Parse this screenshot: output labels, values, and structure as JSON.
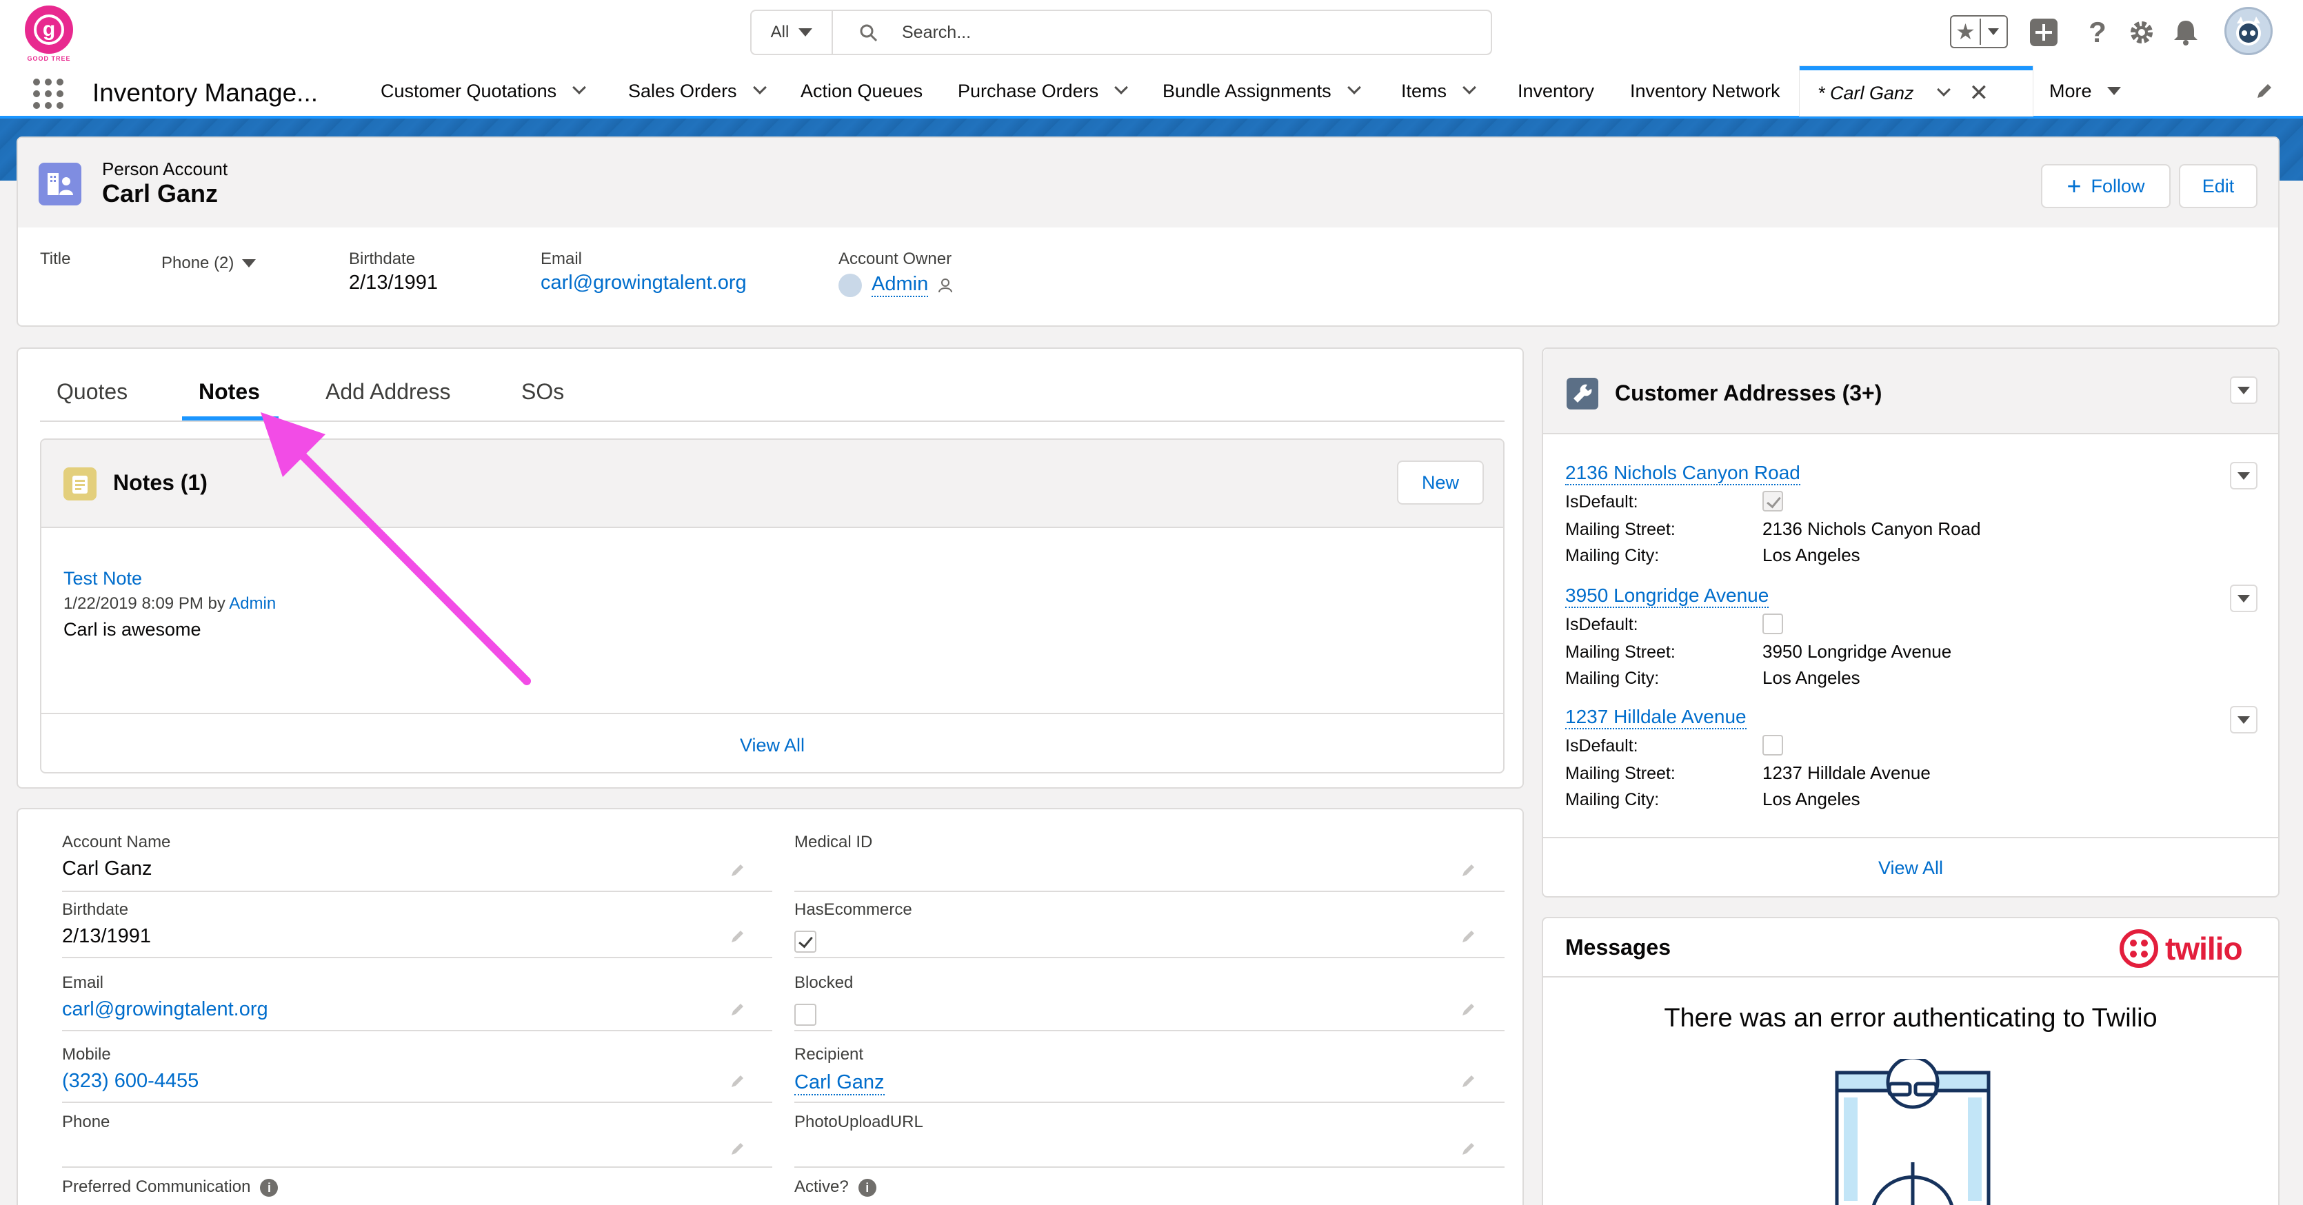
{
  "header": {
    "logo_text": "g",
    "logo_caption": "GOOD TREE",
    "search_scope": "All",
    "search_placeholder": "Search..."
  },
  "nav": {
    "app_name": "Inventory Manage...",
    "items": [
      {
        "label": "Customer Quotations"
      },
      {
        "label": "Sales Orders"
      },
      {
        "label": "Action Queues"
      },
      {
        "label": "Purchase Orders"
      },
      {
        "label": "Bundle Assignments"
      },
      {
        "label": "Items"
      },
      {
        "label": "Inventory"
      },
      {
        "label": "Inventory Network"
      }
    ],
    "active_tab": "* Carl Ganz",
    "more": "More"
  },
  "record": {
    "type": "Person Account",
    "name": "Carl Ganz",
    "follow_label": "Follow",
    "edit_label": "Edit",
    "title_label": "Title",
    "phone_label": "Phone (2)",
    "birthdate_label": "Birthdate",
    "birthdate": "2/13/1991",
    "email_label": "Email",
    "email": "carl@growingtalent.org",
    "owner_label": "Account Owner",
    "owner": "Admin"
  },
  "tabs": {
    "items": [
      "Quotes",
      "Notes",
      "Add Address",
      "SOs"
    ]
  },
  "notes": {
    "title": "Notes (1)",
    "new_label": "New",
    "note_title": "Test Note",
    "note_meta": "1/22/2019 8:09 PM by",
    "note_author": "Admin",
    "note_body": "Carl is awesome",
    "view_all": "View All"
  },
  "details": {
    "account_name_label": "Account Name",
    "account_name": "Carl Ganz",
    "birthdate_label": "Birthdate",
    "birthdate": "2/13/1991",
    "email_label": "Email",
    "email": "carl@growingtalent.org",
    "mobile_label": "Mobile",
    "mobile": "(323) 600-4455",
    "phone_label": "Phone",
    "preferred_label": "Preferred Communication",
    "medical_label": "Medical ID",
    "hasecom_label": "HasEcommerce",
    "hasecom": true,
    "blocked_label": "Blocked",
    "blocked": false,
    "recipient_label": "Recipient",
    "recipient": "Carl Ganz",
    "photo_label": "PhotoUploadURL",
    "active_label": "Active?"
  },
  "addresses": {
    "title": "Customer Addresses (3+)",
    "isdefault_label": "IsDefault:",
    "street_label": "Mailing Street:",
    "city_label": "Mailing City:",
    "items": [
      {
        "name": "2136 Nichols Canyon Road",
        "is_default": true,
        "street": "2136 Nichols Canyon Road",
        "city": "Los Angeles"
      },
      {
        "name": "3950 Longridge Avenue",
        "is_default": false,
        "street": "3950 Longridge Avenue",
        "city": "Los Angeles"
      },
      {
        "name": "1237 Hilldale Avenue",
        "is_default": false,
        "street": "1237 Hilldale Avenue",
        "city": "Los Angeles"
      }
    ],
    "view_all": "View All"
  },
  "messages": {
    "title": "Messages",
    "brand": "twilio",
    "error": "There was an error authenticating to Twilio"
  },
  "colors": {
    "brand_blue": "#0070d2",
    "nav_accent": "#1b96ff",
    "annotation_arrow": "#f24ce6",
    "twilio_red": "#e31e3c",
    "logo_pink": "#e8298f"
  }
}
